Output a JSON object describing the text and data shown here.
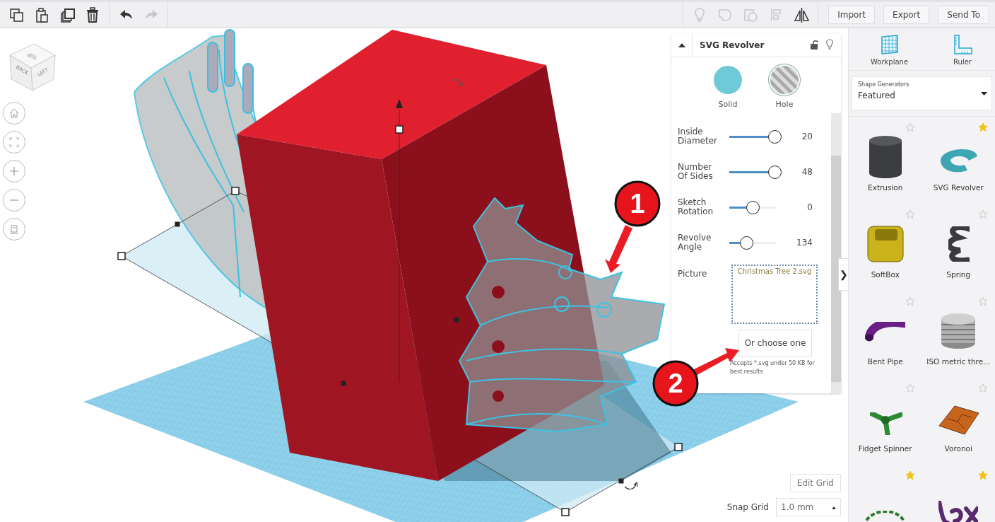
{
  "toolbar": {
    "left_tools": [
      {
        "kind": "copy",
        "disabled": false
      },
      {
        "kind": "paste",
        "disabled": false
      },
      {
        "kind": "duplicate",
        "disabled": false
      },
      {
        "kind": "delete",
        "disabled": false
      },
      {
        "kind": "undo",
        "disabled": false
      },
      {
        "kind": "redo",
        "disabled": true
      }
    ],
    "right_tools": [
      {
        "kind": "bulb",
        "disabled": true
      },
      {
        "kind": "group",
        "disabled": true
      },
      {
        "kind": "ungroup",
        "disabled": true
      },
      {
        "kind": "align",
        "disabled": true
      },
      {
        "kind": "mirror",
        "disabled": false
      }
    ],
    "buttons": [
      "Import",
      "Export",
      "Send To"
    ]
  },
  "view_cube": {
    "faces": [
      "TOP",
      "BACK",
      "LEFT"
    ]
  },
  "view_controls": [
    {
      "kind": "home"
    },
    {
      "kind": "fit"
    },
    {
      "kind": "zoom-in"
    },
    {
      "kind": "zoom-out"
    },
    {
      "kind": "perspective"
    }
  ],
  "inspector": {
    "title": "SVG Revolver",
    "locked": false,
    "swatches": [
      {
        "label": "Solid",
        "kind": "solid"
      },
      {
        "label": "Hole",
        "kind": "hole"
      }
    ],
    "params": [
      {
        "label": "Inside Diameter",
        "level": 0.97,
        "reading": "20"
      },
      {
        "label": "Number Of Sides",
        "level": 0.97,
        "reading": "48"
      },
      {
        "label": "Sketch Rotation",
        "level": 0.5,
        "reading": "0"
      },
      {
        "label": "Revolve Angle",
        "level": 0.37,
        "reading": "134"
      }
    ],
    "picture": {
      "label": "Picture",
      "file": "Christmas Tree 2.svg"
    },
    "choose_button": "Or choose one",
    "hint": "Accepts *.svg under 50 KB for best results"
  },
  "panel_toggle": "❯",
  "callouts": [
    "1",
    "2"
  ],
  "grid": {
    "edit_button": "Edit Grid",
    "snap_label": "Snap Grid",
    "snap_value": "1.0 mm"
  },
  "sidebar": {
    "tools": [
      {
        "label": "Workplane",
        "kind": "workplane"
      },
      {
        "label": "Ruler",
        "kind": "ruler"
      }
    ],
    "category": {
      "caption": "Shape Generators",
      "value": "Featured"
    },
    "shapes": [
      {
        "label": "Extrusion",
        "starred": false
      },
      {
        "label": "SVG Revolver",
        "starred": true
      },
      {
        "label": "SoftBox",
        "starred": false
      },
      {
        "label": "Spring",
        "starred": false
      },
      {
        "label": "Bent Pipe",
        "starred": false
      },
      {
        "label": "ISO metric thre...",
        "starred": false
      },
      {
        "label": "Fidget Spinner",
        "starred": false
      },
      {
        "label": "Voronoi",
        "starred": false
      },
      {
        "starred": true
      },
      {
        "starred": true
      }
    ]
  }
}
